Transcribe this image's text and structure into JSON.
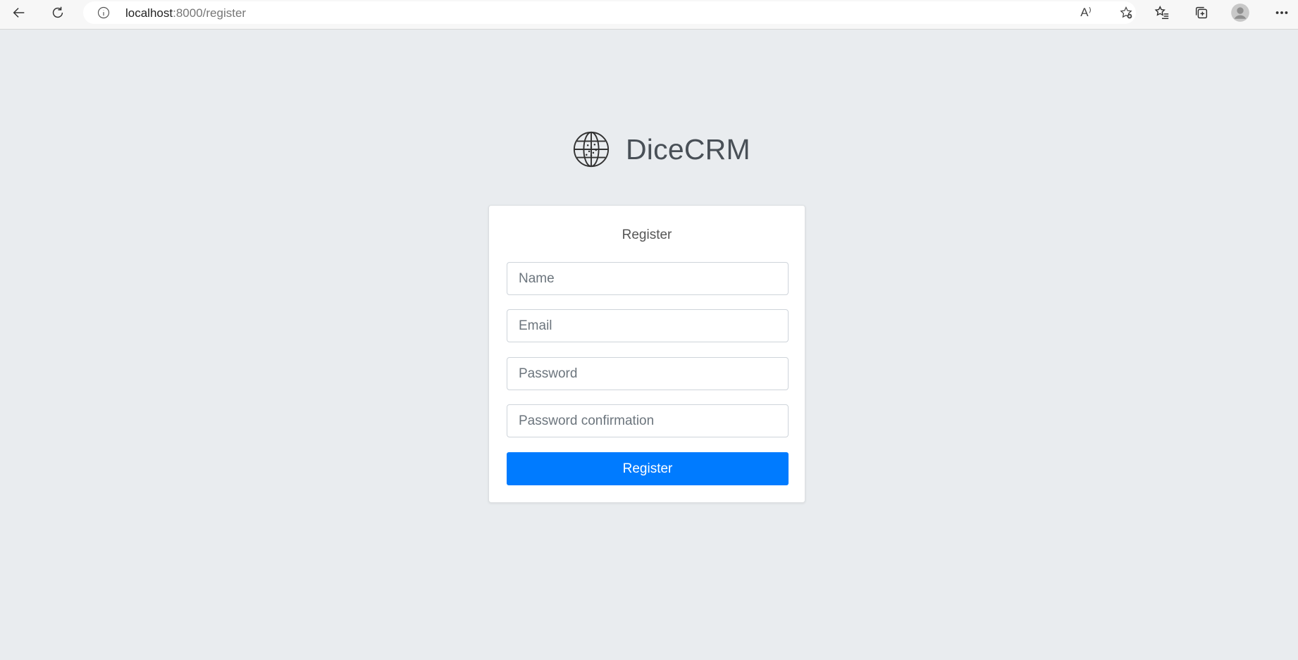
{
  "browser": {
    "url_host": "localhost",
    "url_path": ":8000/register",
    "read_aloud_glyph": "A⁾"
  },
  "icons": {
    "back": "arrow-left-icon",
    "refresh": "refresh-icon",
    "site_info": "info-icon",
    "read_aloud": "read-aloud-icon",
    "add_favorite": "star-plus-icon",
    "favorites": "favorites-icon",
    "collections": "collections-icon",
    "profile": "profile-icon",
    "more": "more-icon",
    "logo": "globe-icon"
  },
  "brand": {
    "name": "DiceCRM"
  },
  "form": {
    "title": "Register",
    "name_placeholder": "Name",
    "email_placeholder": "Email",
    "password_placeholder": "Password",
    "password_confirmation_placeholder": "Password confirmation",
    "submit_label": "Register"
  },
  "colors": {
    "primary": "#007bff",
    "page_background": "#e9ecef"
  }
}
